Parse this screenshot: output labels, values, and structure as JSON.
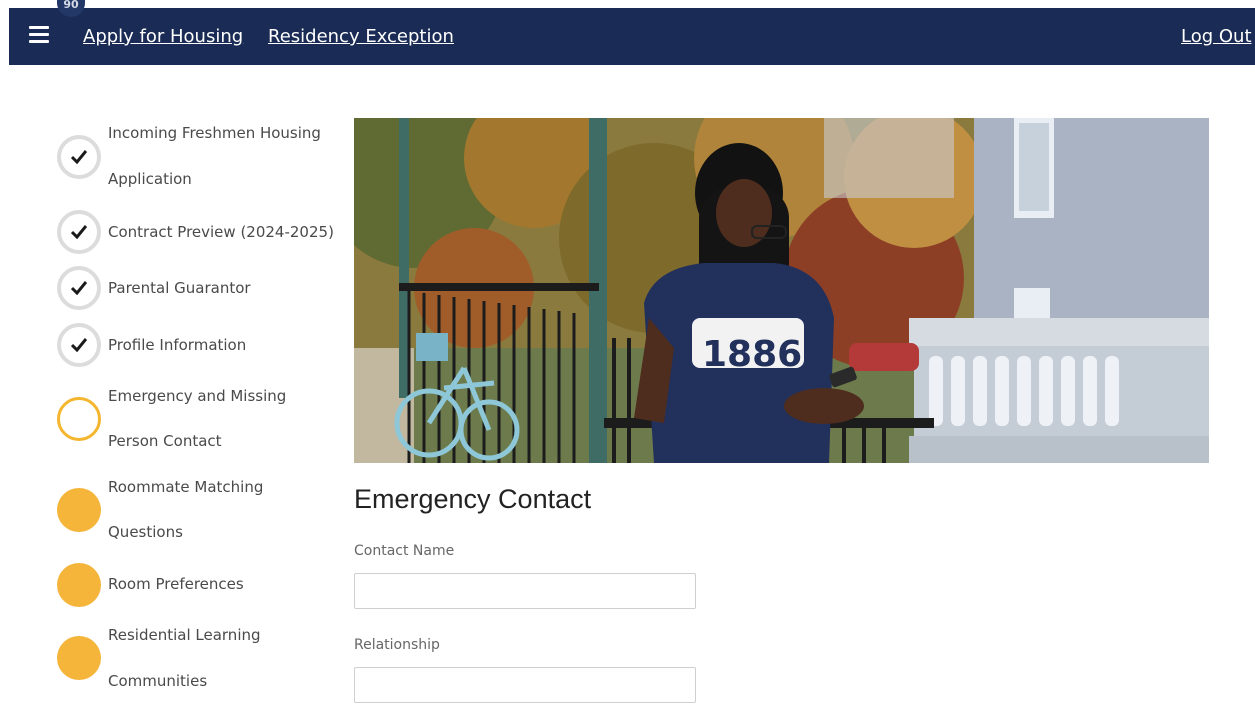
{
  "header": {
    "badge": "90",
    "nav": [
      {
        "label": "Apply for Housing"
      },
      {
        "label": "Residency Exception"
      }
    ],
    "logout_label": "Log Out"
  },
  "steps": [
    {
      "line1": "Incoming Freshmen Housing",
      "line2": "Application",
      "status": "complete"
    },
    {
      "line1": "Contract Preview (2024-2025)",
      "line2": "",
      "status": "complete"
    },
    {
      "line1": "Parental Guarantor",
      "line2": "",
      "status": "complete"
    },
    {
      "line1": "Profile Information",
      "line2": "",
      "status": "complete"
    },
    {
      "line1": "Emergency and Missing",
      "line2": "Person Contact",
      "status": "current"
    },
    {
      "line1": "Roommate Matching",
      "line2": "Questions",
      "status": "incomplete"
    },
    {
      "line1": "Room Preferences",
      "line2": "",
      "status": "incomplete"
    },
    {
      "line1": "Residential Learning",
      "line2": "Communities",
      "status": "incomplete"
    }
  ],
  "hero": {
    "shirt_text": "1886"
  },
  "form": {
    "title": "Emergency Contact",
    "contact_name_label": "Contact Name",
    "contact_name_value": "",
    "relationship_label": "Relationship",
    "relationship_value": ""
  },
  "colors": {
    "header_bg": "#1a2c55",
    "accent": "#f4b53a",
    "check": "#1a1a1a"
  },
  "icons": {
    "menu": "hamburger-icon",
    "complete": "checkmark-icon",
    "current": "ring-icon",
    "incomplete": "filled-circle-icon"
  }
}
